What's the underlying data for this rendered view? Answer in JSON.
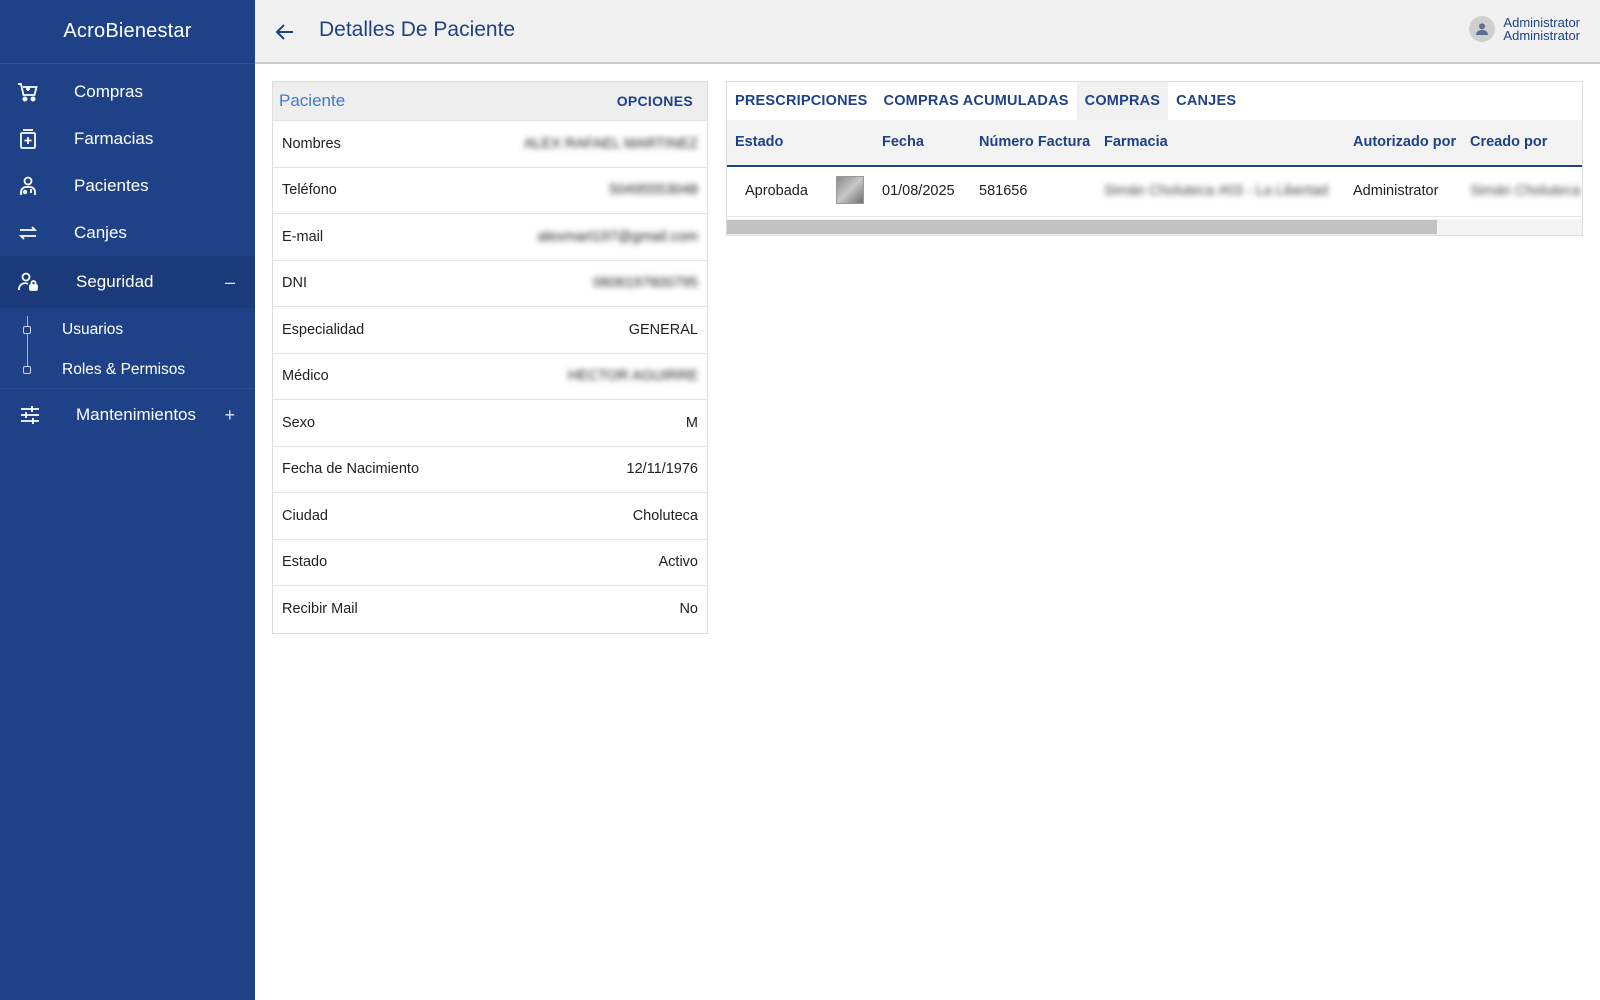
{
  "app": {
    "name": "AcroBienestar"
  },
  "sidebar": {
    "items": [
      {
        "label": "Compras",
        "icon": "cart-icon"
      },
      {
        "label": "Farmacias",
        "icon": "pharmacy-icon"
      },
      {
        "label": "Pacientes",
        "icon": "patient-icon"
      },
      {
        "label": "Canjes",
        "icon": "swap-icon"
      },
      {
        "label": "Seguridad",
        "icon": "user-lock-icon",
        "toggle": "–",
        "expanded": true
      },
      {
        "label": "Mantenimientos",
        "icon": "sliders-icon",
        "toggle": "+"
      }
    ],
    "security_children": [
      "Usuarios",
      "Roles & Permisos"
    ]
  },
  "header": {
    "title": "Detalles De Paciente",
    "user_line1": "Administrator",
    "user_line2": "Administrator"
  },
  "patient": {
    "title": "Paciente",
    "options_label": "OPCIONES",
    "fields": [
      {
        "label": "Nombres",
        "value": "ALEX RAFAEL MARTINEZ",
        "blurred": true
      },
      {
        "label": "Teléfono",
        "value": "50495553048",
        "blurred": true
      },
      {
        "label": "E-mail",
        "value": "alexmart197@gmail.com",
        "blurred": true
      },
      {
        "label": "DNI",
        "value": "0606197600795",
        "blurred": true
      },
      {
        "label": "Especialidad",
        "value": "GENERAL"
      },
      {
        "label": "Médico",
        "value": "HECTOR AGUIRRE",
        "blurred": true
      },
      {
        "label": "Sexo",
        "value": "M"
      },
      {
        "label": "Fecha de Nacimiento",
        "value": "12/11/1976"
      },
      {
        "label": "Ciudad",
        "value": "Choluteca"
      },
      {
        "label": "Estado",
        "value": "Activo"
      },
      {
        "label": "Recibir Mail",
        "value": "No"
      }
    ]
  },
  "tabs": {
    "items": [
      "PRESCRIPCIONES",
      "COMPRAS ACUMULADAS",
      "COMPRAS",
      "CANJES"
    ],
    "active_index": 2
  },
  "table": {
    "columns": [
      "Estado",
      "Fecha",
      "Número Factura",
      "Farmacia",
      "Autorizado por",
      "Creado por"
    ],
    "rows": [
      {
        "estado": "Aprobada",
        "fecha": "01/08/2025",
        "factura": "581656",
        "farmacia": "Simán Choluteca #03 - La Libertad",
        "autorizado": "Administrator",
        "creado": "Simán Choluteca"
      }
    ]
  },
  "colors": {
    "sidebar": "#1e4188",
    "accent": "#1e4188",
    "card_title": "#3d7bd0"
  }
}
